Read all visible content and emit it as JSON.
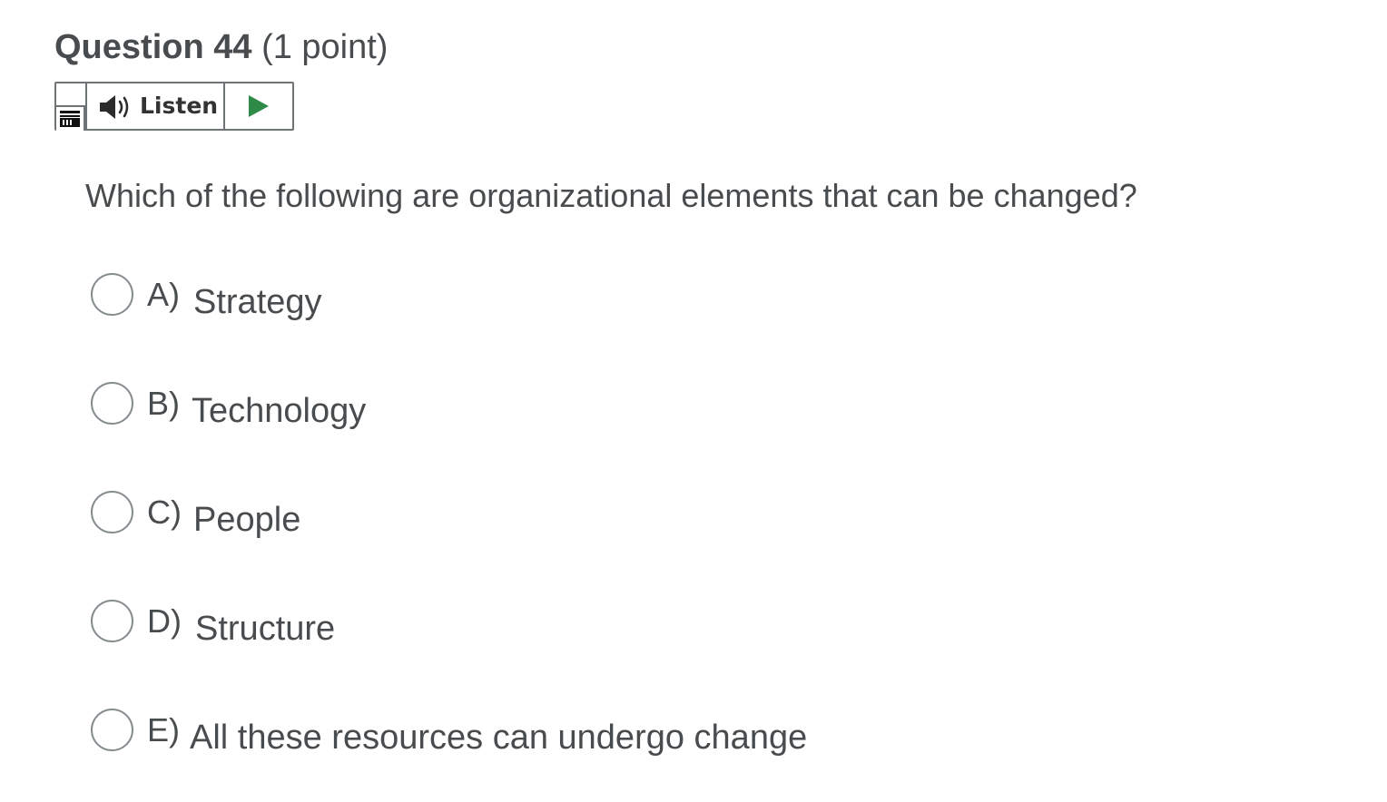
{
  "question": {
    "title": "Question 44",
    "points": "(1 point)",
    "text": "Which of the following are organizational elements that can be changed?"
  },
  "listen_widget": {
    "listen_label": "Listen",
    "icons": [
      "menu-icon",
      "speaker-icon",
      "play-icon"
    ],
    "play_color": "#2e8b47"
  },
  "options": [
    {
      "letter": "A)",
      "text": "Strategy",
      "selected": false
    },
    {
      "letter": "B)",
      "text": "Technology",
      "selected": false
    },
    {
      "letter": "C)",
      "text": "People",
      "selected": false
    },
    {
      "letter": "D)",
      "text": "Structure",
      "selected": false
    },
    {
      "letter": "E)",
      "text": "All these resources can undergo change",
      "selected": false
    }
  ]
}
